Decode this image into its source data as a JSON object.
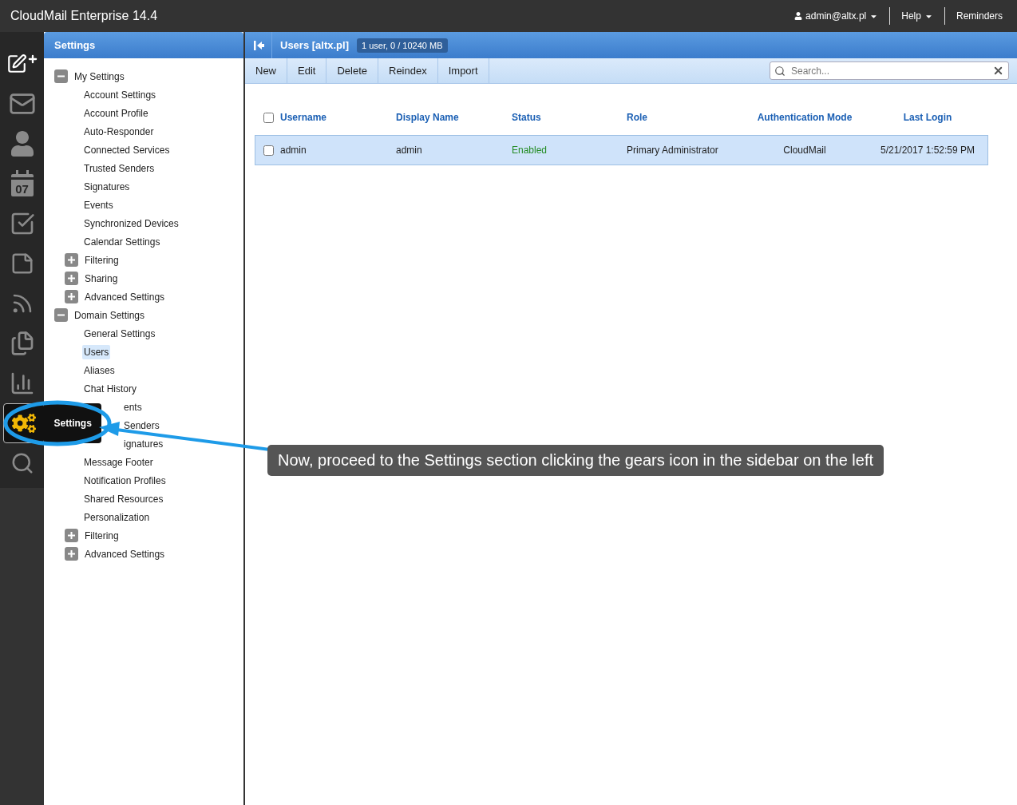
{
  "app_title": "CloudMail Enterprise 14.4",
  "header_menu": [
    {
      "kind": "user",
      "label": "admin@altx.pl",
      "caret": true
    },
    {
      "kind": "plain",
      "label": "Help",
      "caret": true
    },
    {
      "kind": "plain",
      "label": "Reminders",
      "caret": false
    }
  ],
  "rail": [
    {
      "selected": false
    },
    {
      "selected": false
    },
    {
      "selected": false
    },
    {
      "selected": false,
      "text": "07"
    },
    {
      "selected": false
    },
    {
      "selected": false
    },
    {
      "selected": false
    },
    {
      "selected": false
    },
    {
      "selected": false
    },
    {
      "selected": true,
      "flyout": "Settings"
    },
    {
      "selected": false
    }
  ],
  "settings_panel": {
    "title": "Settings",
    "tree": [
      {
        "label": "My Settings",
        "expanded": true,
        "selected": false,
        "children": [
          {
            "label": "Account Settings",
            "selected": false
          },
          {
            "label": "Account Profile",
            "selected": false
          },
          {
            "label": "Auto-Responder",
            "selected": false
          },
          {
            "label": "Connected Services",
            "selected": false
          },
          {
            "label": "Trusted Senders",
            "selected": false
          },
          {
            "label": "Signatures",
            "selected": false
          },
          {
            "label": "Events",
            "selected": false
          },
          {
            "label": "Synchronized Devices",
            "selected": false
          },
          {
            "label": "Calendar Settings",
            "selected": false
          },
          {
            "label": "Filtering",
            "expanded": false,
            "selected": false
          },
          {
            "label": "Sharing",
            "expanded": false,
            "selected": false
          },
          {
            "label": "Advanced Settings",
            "expanded": false,
            "selected": false
          }
        ]
      },
      {
        "label": "Domain Settings",
        "expanded": true,
        "selected": false,
        "children": [
          {
            "label": "General Settings",
            "selected": false
          },
          {
            "label": "Users",
            "selected": true
          },
          {
            "label": "Aliases",
            "selected": false
          },
          {
            "label": "Chat History",
            "selected": false
          },
          {
            "label": "ents",
            "selected": false,
            "kind": "clipped"
          },
          {
            "label": "Senders",
            "selected": false,
            "kind": "clipped"
          },
          {
            "label": "ignatures",
            "selected": false,
            "kind": "clipped"
          },
          {
            "label": "Message Footer",
            "selected": false
          },
          {
            "label": "Notification Profiles",
            "selected": false
          },
          {
            "label": "Shared Resources",
            "selected": false
          },
          {
            "label": "Personalization",
            "selected": false
          },
          {
            "label": "Filtering",
            "expanded": false,
            "selected": false
          },
          {
            "label": "Advanced Settings",
            "expanded": false,
            "selected": false
          }
        ]
      }
    ]
  },
  "main": {
    "title": "Users [altx.pl]",
    "badge": "1 user, 0 / 10240 MB",
    "toolbar": [
      "New",
      "Edit",
      "Delete",
      "Reindex",
      "Import"
    ],
    "search": {
      "placeholder": "Search..."
    },
    "table": {
      "select_all_checked": false,
      "columns": [
        "Username",
        "Display Name",
        "Status",
        "Role",
        "Authentication Mode",
        "Last Login"
      ],
      "rows": [
        {
          "selected": true,
          "checked": false,
          "cells": [
            "admin",
            "admin",
            "Enabled",
            "Primary Administrator",
            "CloudMail",
            "5/21/2017 1:52:59 PM"
          ]
        }
      ]
    }
  },
  "callout": "Now, proceed to the Settings section clicking the gears icon in the sidebar on the left"
}
